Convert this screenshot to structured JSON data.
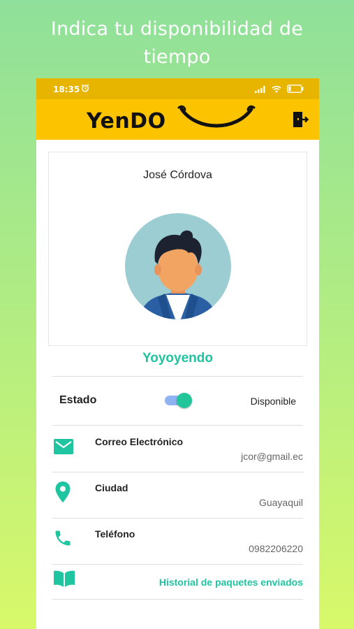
{
  "headline": {
    "line1": "Indica tu disponibilidad de",
    "line2": "tiempo"
  },
  "status_bar": {
    "time": "18:35",
    "icons": [
      "alarm-icon",
      "signal-icon",
      "wifi-icon",
      "battery-icon"
    ]
  },
  "app_bar": {
    "logo": "YenDO",
    "exit_icon": "exit-door-icon"
  },
  "profile": {
    "name": "José Córdova",
    "nickname": "Yoyoyendo"
  },
  "status": {
    "label": "Estado",
    "toggle_on": true,
    "value": "Disponible"
  },
  "info_rows": [
    {
      "icon": "mail-icon",
      "label": "Correo Electrónico",
      "value": "jcor@gmail.ec"
    },
    {
      "icon": "location-pin-icon",
      "label": "Ciudad",
      "value": "Guayaquil"
    },
    {
      "icon": "phone-icon",
      "label": "Teléfono",
      "value": "0982206220"
    }
  ],
  "history": {
    "icon": "book-icon",
    "label": "Historial de paquetes enviados"
  },
  "colors": {
    "accent": "#1fc4a0",
    "appbar": "#fcc300",
    "statusbar": "#e7b400"
  }
}
